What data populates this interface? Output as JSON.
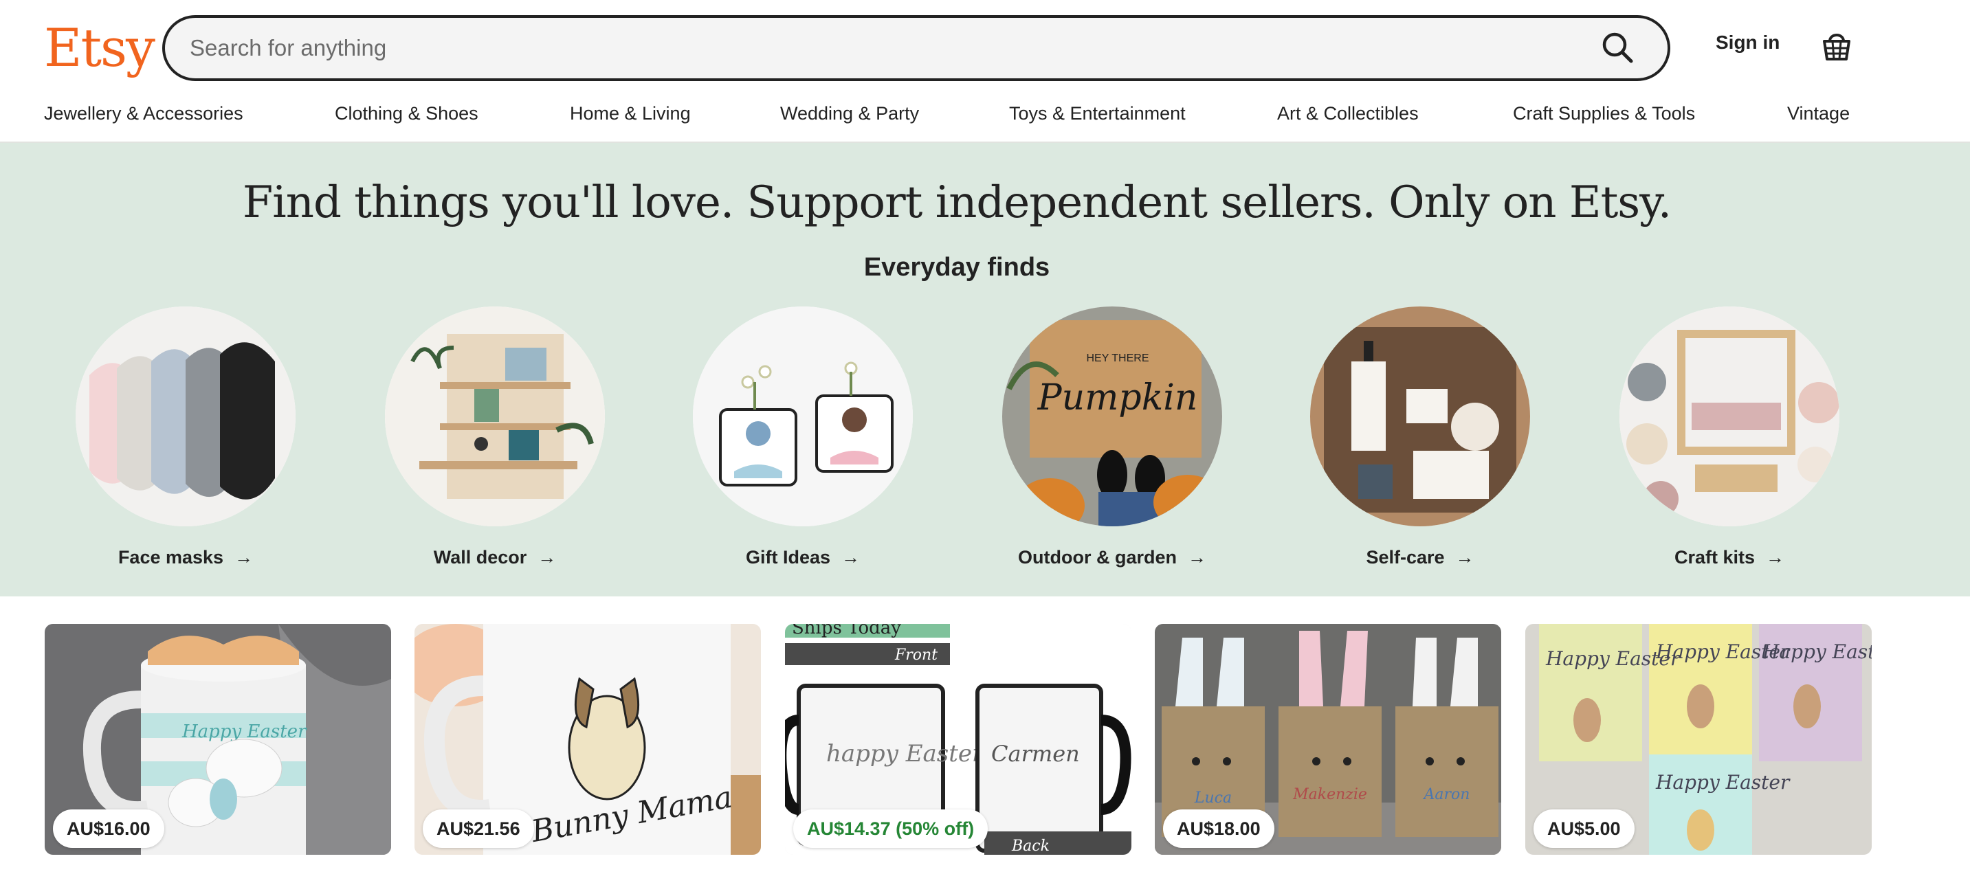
{
  "header": {
    "logo": "Etsy",
    "search_placeholder": "Search for anything",
    "sign_in": "Sign in",
    "basket_icon": "basket-icon"
  },
  "nav": {
    "items": [
      "Jewellery & Accessories",
      "Clothing & Shoes",
      "Home & Living",
      "Wedding & Party",
      "Toys & Entertainment",
      "Art & Collectibles",
      "Craft Supplies & Tools",
      "Vintage"
    ]
  },
  "hero": {
    "title": "Find things you'll love. Support independent sellers. Only on Etsy.",
    "subtitle": "Everyday finds",
    "categories": [
      {
        "label": "Face masks"
      },
      {
        "label": "Wall decor"
      },
      {
        "label": "Gift Ideas"
      },
      {
        "label": "Outdoor & garden"
      },
      {
        "label": "Self-care"
      },
      {
        "label": "Craft kits"
      }
    ],
    "arrow": "→"
  },
  "listings": [
    {
      "price": "AU$16.00"
    },
    {
      "price": "AU$21.56"
    },
    {
      "price": "AU$14.37 (50% off)"
    },
    {
      "price": "AU$18.00"
    },
    {
      "price": "AU$5.00"
    }
  ],
  "image_text": {
    "mug1": "Happy Easter",
    "mug2": "Bunny Mama",
    "mug3_banner": "Ships Today",
    "mug3_front": "Front",
    "mug3_back": "Back",
    "mug3_left": "happy Easter",
    "mug3_right": "Carmen",
    "bags": [
      "Luca",
      "Makenzie",
      "Aaron"
    ],
    "cards": "Happy Easter",
    "mat_top": "HEY THERE",
    "mat": "Pumpkin"
  },
  "colors": {
    "brand": "#f1641e",
    "hero_bg": "#dce9e0",
    "sale": "#258635"
  }
}
